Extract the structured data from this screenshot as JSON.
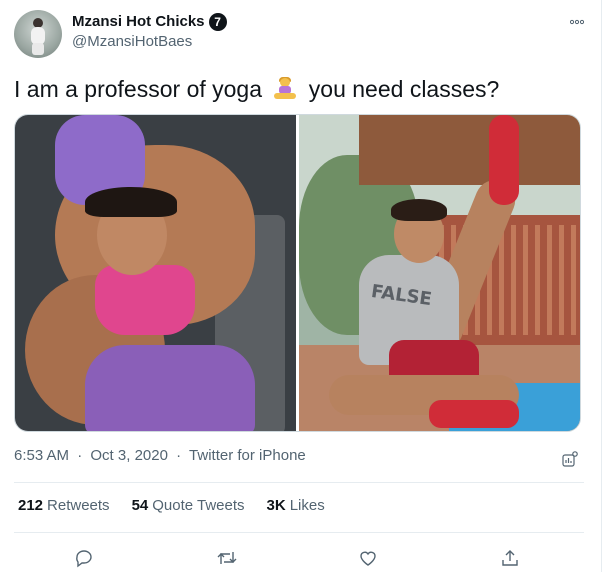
{
  "tweet": {
    "display_name": "Mzansi Hot Chicks",
    "badge": "7",
    "handle": "@MzansiHotBaes",
    "text_before": "I am a professor of yoga",
    "emoji": "person-in-lotus-position-emoji",
    "text_after": "you need classes?",
    "time": "6:53 AM",
    "date": "Oct 3, 2020",
    "source": "Twitter for iPhone",
    "separator": "·",
    "more_icon": "ellipsis-icon",
    "shirt_print": "FALSE"
  },
  "stats": {
    "retweets": {
      "value": "212",
      "label": "Retweets"
    },
    "quote_tweets": {
      "value": "54",
      "label": "Quote Tweets"
    },
    "likes": {
      "value": "3K",
      "label": "Likes"
    }
  },
  "actions": [
    "reply-icon",
    "retweet-icon",
    "like-icon",
    "share-icon"
  ],
  "colors": {
    "text": "#0f1419",
    "secondary": "#536471",
    "border": "#e6ecf0"
  }
}
